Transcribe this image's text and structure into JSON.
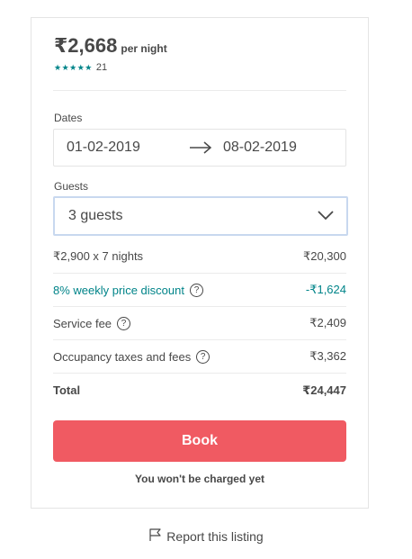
{
  "listing": {
    "price": "₹2,668",
    "per_night": "per night",
    "stars": "★★★★★",
    "review_count": "21"
  },
  "dates": {
    "label": "Dates",
    "check_in": "01-02-2019",
    "check_out": "08-02-2019"
  },
  "guests": {
    "label": "Guests",
    "selected": "3 guests"
  },
  "breakdown": {
    "nights_label": "₹2,900 x 7 nights",
    "nights_value": "₹20,300",
    "discount_label": "8% weekly price discount",
    "discount_value": "-₹1,624",
    "service_label": "Service fee",
    "service_value": "₹2,409",
    "taxes_label": "Occupancy taxes and fees",
    "taxes_value": "₹3,362",
    "total_label": "Total",
    "total_value": "₹24,447",
    "help_glyph": "?"
  },
  "actions": {
    "book_label": "Book",
    "note": "You won't be charged yet",
    "report_label": "Report this listing"
  },
  "colors": {
    "accent": "#f05a62",
    "teal": "#008489",
    "text": "#484848"
  }
}
